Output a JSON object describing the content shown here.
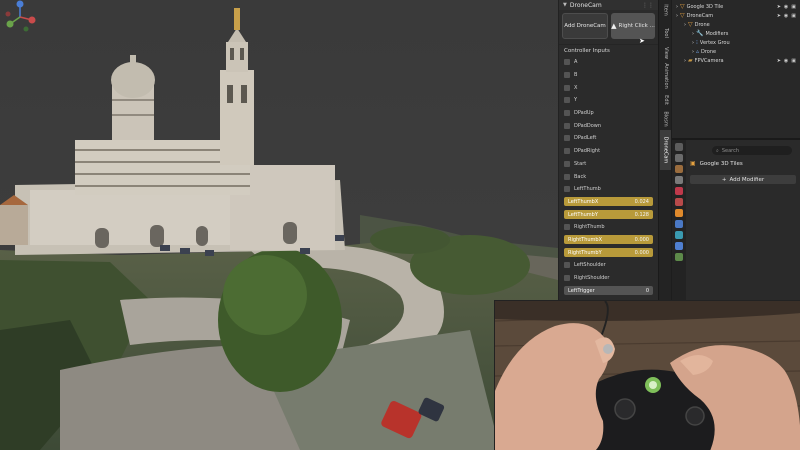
{
  "viewport": {
    "scene": "Google 3D Tiles photogrammetry view of a hilltop basilica",
    "colors": {
      "sky": "#3b3b3b",
      "stone": "#c9c2b6",
      "trees": "#3f5a2c",
      "road": "#b7b2aa"
    }
  },
  "npanel": {
    "title": "DroneCam",
    "add_button": "Add DroneCam",
    "right_click_button": "Right Click ...",
    "controller_section": "Controller Inputs",
    "checkboxes": [
      "A",
      "B",
      "X",
      "Y",
      "DPadUp",
      "DPadDown",
      "DPadLeft",
      "DPadRight",
      "Start",
      "Back",
      "LeftThumb"
    ],
    "axis_fields": [
      {
        "label": "LeftThumbX",
        "value": "0.024"
      },
      {
        "label": "LeftThumbY",
        "value": "0.128"
      }
    ],
    "right_thumb": "RightThumb",
    "axis_fields2": [
      {
        "label": "RightThumbX",
        "value": "0.000"
      },
      {
        "label": "RightThumbY",
        "value": "0.000"
      }
    ],
    "shoulders": [
      "LeftShoulder",
      "RightShoulder"
    ],
    "trigger": {
      "label": "LeftTrigger",
      "value": "0"
    },
    "accent_color": "#b89a3a"
  },
  "tabs": [
    "Item",
    "Tool",
    "View",
    "Animation",
    "Edit",
    "Blosm",
    "DroneCam"
  ],
  "outliner": {
    "rows": [
      {
        "label": "Google 3D Tile",
        "indent": 0,
        "icon": "object-icon"
      },
      {
        "label": "DroneCam",
        "indent": 0,
        "icon": "collection-icon"
      },
      {
        "label": "Drone",
        "indent": 1,
        "icon": "object-icon"
      },
      {
        "label": "Modifiers",
        "indent": 2,
        "icon": "wrench-icon"
      },
      {
        "label": "Vertex Grou",
        "indent": 2,
        "icon": "vertex-group-icon"
      },
      {
        "label": "Drone",
        "indent": 2,
        "icon": "mesh-icon"
      },
      {
        "label": "FPVCamera",
        "indent": 1,
        "icon": "camera-icon"
      }
    ]
  },
  "properties": {
    "search_placeholder": "Search",
    "object_name": "Google 3D Tiles",
    "add_modifier": "Add Modifier"
  }
}
